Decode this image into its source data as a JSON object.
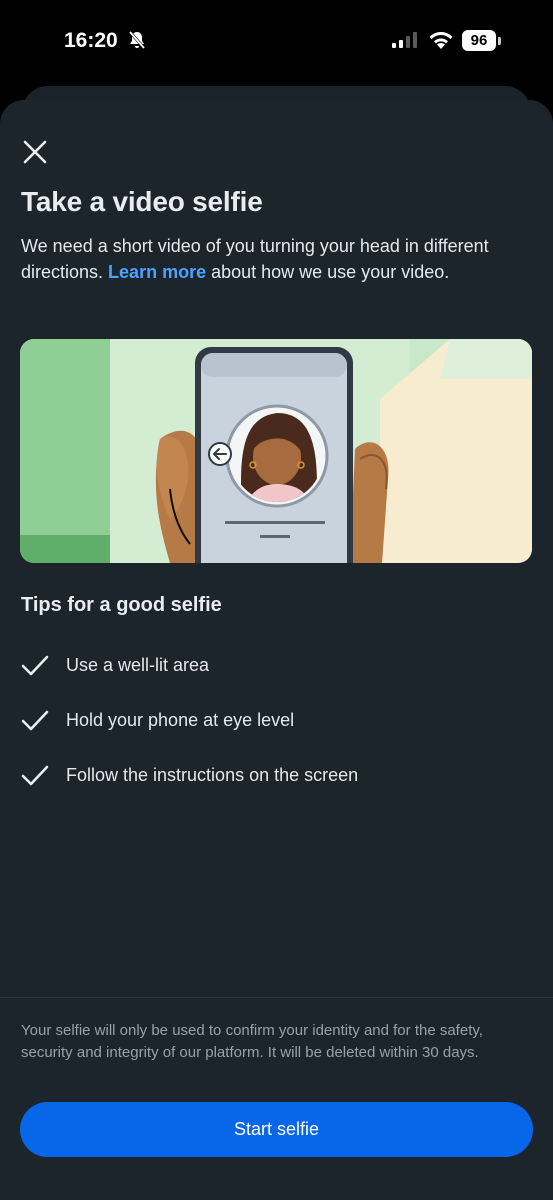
{
  "status_bar": {
    "time": "16:20",
    "battery": "96"
  },
  "sheet": {
    "close_icon": "close-icon",
    "title": "Take a video selfie",
    "description_before_link": "We need a short video of you turning your head in different directions. ",
    "learn_more_link": "Learn more",
    "description_after_link": " about how we use your video.",
    "illustration": "phone-selfie-illustration"
  },
  "tips": {
    "heading": "Tips for a good selfie",
    "items": [
      {
        "icon": "checkmark-icon",
        "label": "Use a well-lit area"
      },
      {
        "icon": "checkmark-icon",
        "label": "Hold your phone at eye level"
      },
      {
        "icon": "checkmark-icon",
        "label": "Follow the instructions on the screen"
      }
    ]
  },
  "footer": {
    "disclaimer": "Your selfie will only be used to confirm your identity and for the safety, security and integrity of our platform. It will be deleted within 30 days.",
    "start_button": "Start selfie"
  },
  "colors": {
    "accent": "#0866e8",
    "link": "#4aa3ff",
    "background": "#1c252c"
  }
}
